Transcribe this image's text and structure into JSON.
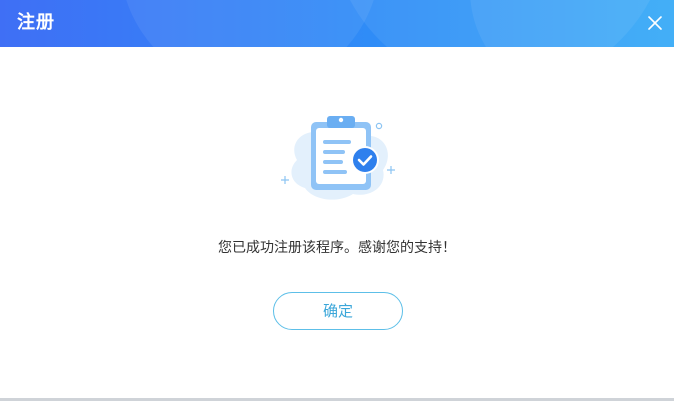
{
  "dialog": {
    "title": "注册",
    "message": "您已成功注册该程序。感谢您的支持！",
    "confirm_label": "确定",
    "icons": {
      "close": "close-icon",
      "illustration": "clipboard-check-icon"
    },
    "colors": {
      "title_bar_start": "#3f6ff5",
      "title_bar_end": "#35a9f7",
      "button_border": "#5dbfe8",
      "button_text": "#3aa6d9",
      "clipboard_accent": "#2f80ed"
    }
  }
}
